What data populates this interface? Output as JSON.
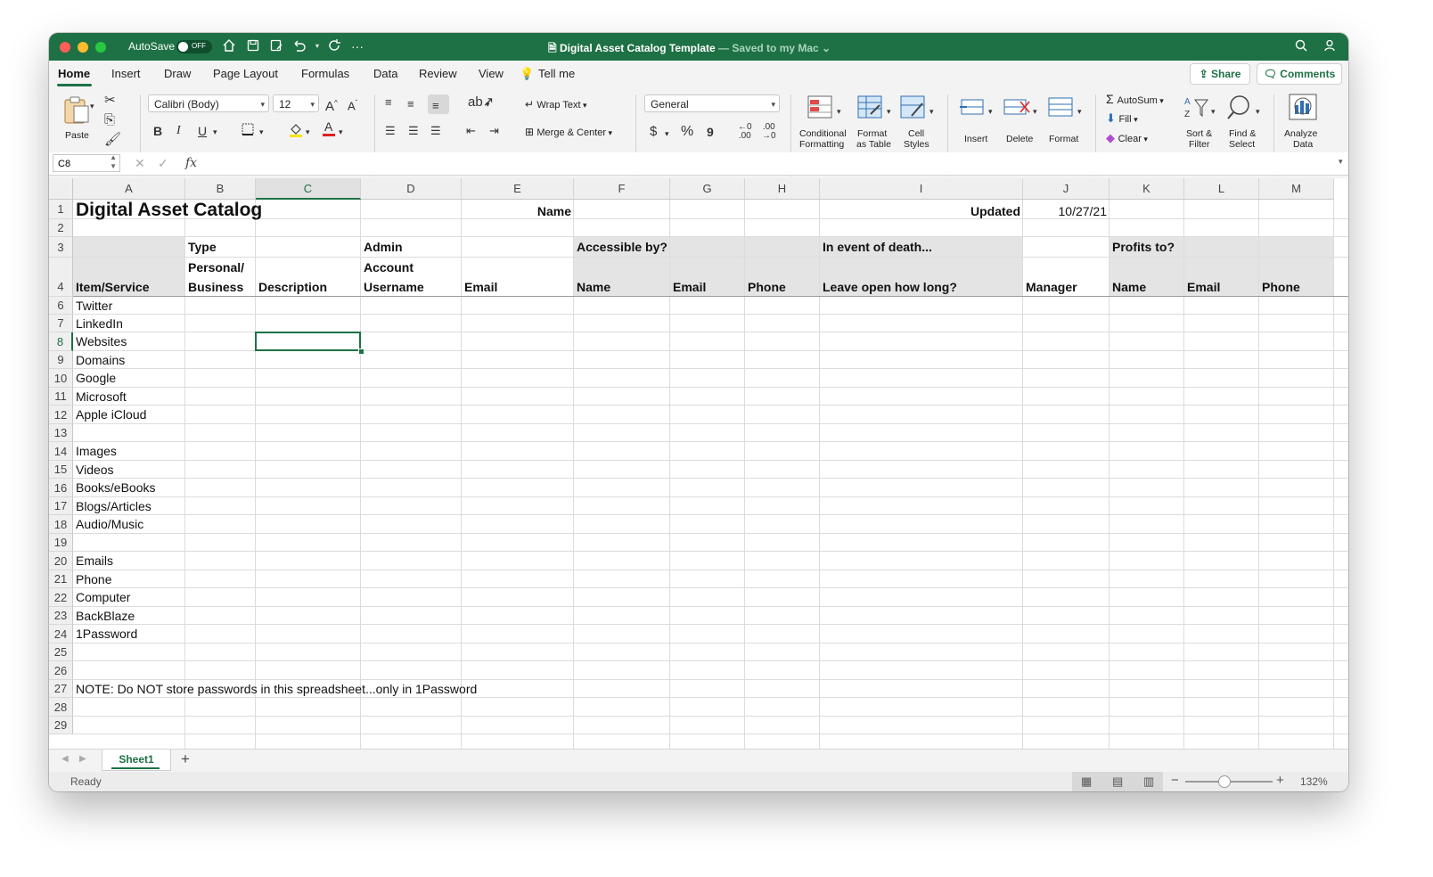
{
  "titlebar": {
    "autosave_label": "AutoSave",
    "autosave_state": "OFF",
    "doc_title": "Digital Asset Catalog Template",
    "doc_status": " — Saved to my Mac",
    "bg_color": "#1e7145"
  },
  "tabs": {
    "home": "Home",
    "insert": "Insert",
    "draw": "Draw",
    "page_layout": "Page Layout",
    "formulas": "Formulas",
    "data": "Data",
    "review": "Review",
    "view": "View",
    "tell_me": "Tell me",
    "share": "Share",
    "comments": "Comments"
  },
  "ribbon": {
    "paste": "Paste",
    "font_name": "Calibri (Body)",
    "font_size": "12",
    "bold": "B",
    "italic": "I",
    "underline": "U",
    "wrap_text": "Wrap Text",
    "merge_center": "Merge & Center",
    "number_format": "General",
    "currency": "$",
    "percent": "%",
    "comma": "9",
    "conditional_formatting_1": "Conditional",
    "conditional_formatting_2": "Formatting",
    "format_as_table_1": "Format",
    "format_as_table_2": "as Table",
    "cell_styles_1": "Cell",
    "cell_styles_2": "Styles",
    "insert": "Insert",
    "delete": "Delete",
    "format": "Format",
    "autosum": "AutoSum",
    "fill": "Fill",
    "clear": "Clear",
    "sort_filter_1": "Sort &",
    "sort_filter_2": "Filter",
    "find_select_1": "Find &",
    "find_select_2": "Select",
    "analyze_data_1": "Analyze",
    "analyze_data_2": "Data"
  },
  "formula_bar": {
    "name_box": "C8",
    "fx": "fx",
    "content": ""
  },
  "columns": [
    "A",
    "B",
    "C",
    "D",
    "E",
    "F",
    "G",
    "H",
    "I",
    "J",
    "K",
    "L",
    "M"
  ],
  "rows": [
    "1",
    "2",
    "3",
    "4",
    "6",
    "7",
    "8",
    "9",
    "10",
    "11",
    "12",
    "13",
    "14",
    "15",
    "16",
    "17",
    "18",
    "19",
    "20",
    "21",
    "22",
    "23",
    "24",
    "25",
    "26",
    "27",
    "28",
    "29"
  ],
  "cells": {
    "A1": "Digital Asset Catalog",
    "E1": "Name",
    "I1": "Updated",
    "J1": "10/27/21",
    "B3": "Type",
    "D3": "Admin",
    "F3": "Accessible by?",
    "I3": "In event of death...",
    "K3": "Profits to?",
    "B4a": "Personal/",
    "B4b": "Business",
    "D4a": "Account",
    "D4b": "Username",
    "A4": "Item/Service",
    "C4": "Description",
    "E4": "Email",
    "F4": "Name",
    "G4": "Email",
    "H4": "Phone",
    "I4": "Leave open how long?",
    "J4": "Manager",
    "K4": "Name",
    "L4": "Email",
    "M4": "Phone",
    "A6": "Twitter",
    "A7": "LinkedIn",
    "A8": "Websites",
    "A9": "Domains",
    "A10": "Google",
    "A11": "Microsoft",
    "A12": "Apple iCloud",
    "A14": "Images",
    "A15": "Videos",
    "A16": "Books/eBooks",
    "A17": "Blogs/Articles",
    "A18": "Audio/Music",
    "A20": "Emails",
    "A21": "Phone",
    "A22": "Computer",
    "A23": "BackBlaze",
    "A24": "1Password",
    "A27": "NOTE: Do NOT store passwords in this spreadsheet...only in 1Password"
  },
  "sheets": {
    "active": "Sheet1",
    "add": "+"
  },
  "status": {
    "state": "Ready",
    "zoom": "132%",
    "zoom_level_fraction": 0.45
  }
}
